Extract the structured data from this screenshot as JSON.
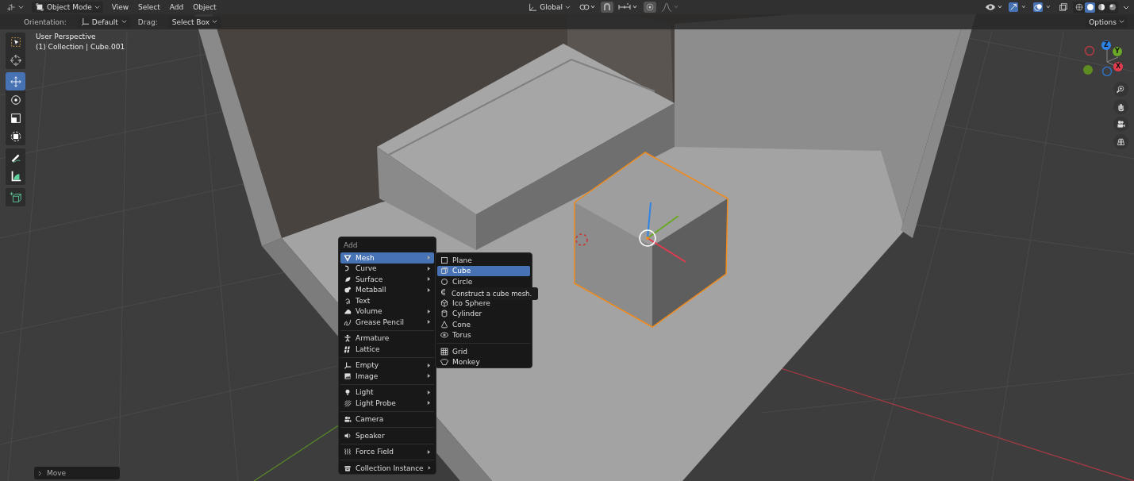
{
  "header": {
    "mode": "Object Mode",
    "menus": [
      "View",
      "Select",
      "Add",
      "Object"
    ],
    "transform_orientation": "Global",
    "shading": [
      {
        "kind": "wireframe",
        "selected": false
      },
      {
        "kind": "solid",
        "selected": true
      },
      {
        "kind": "material",
        "selected": false
      },
      {
        "kind": "rendered",
        "selected": false
      }
    ]
  },
  "tool_settings": {
    "orientation_label": "Orientation:",
    "orientation": "Default",
    "drag_label": "Drag:",
    "drag": "Select Box",
    "options": "Options"
  },
  "viewport": {
    "title": "User Perspective",
    "subtitle": "(1) Collection | Cube.001"
  },
  "toolbar": [
    [
      {
        "kind": "select-box",
        "selected": false
      },
      {
        "kind": "cursor",
        "selected": false
      }
    ],
    [
      {
        "kind": "move",
        "selected": true
      },
      {
        "kind": "rotate",
        "selected": false
      },
      {
        "kind": "scale",
        "selected": false
      },
      {
        "kind": "transform",
        "selected": false
      }
    ],
    [
      {
        "kind": "annotate",
        "selected": false
      },
      {
        "kind": "measure",
        "selected": false
      }
    ],
    [
      {
        "kind": "add-cube",
        "selected": false
      }
    ]
  ],
  "gizmo_axes": [
    {
      "label": "Z",
      "color": "#2e83e6"
    },
    {
      "label": "Y",
      "color": "#6ba827"
    },
    {
      "label": "X",
      "color": "#e63a4f"
    }
  ],
  "add_menu": {
    "title": "Add",
    "sections": [
      [
        {
          "label": "Mesh",
          "submenu": true,
          "selected": true
        },
        {
          "label": "Curve",
          "submenu": true,
          "selected": false
        },
        {
          "label": "Surface",
          "submenu": true,
          "selected": false
        },
        {
          "label": "Metaball",
          "submenu": true,
          "selected": false
        },
        {
          "label": "Text",
          "submenu": false,
          "selected": false
        },
        {
          "label": "Volume",
          "submenu": true,
          "selected": false
        },
        {
          "label": "Grease Pencil",
          "submenu": true,
          "selected": false
        }
      ],
      [
        {
          "label": "Armature",
          "submenu": false,
          "selected": false
        },
        {
          "label": "Lattice",
          "submenu": false,
          "selected": false
        }
      ],
      [
        {
          "label": "Empty",
          "submenu": true,
          "selected": false
        },
        {
          "label": "Image",
          "submenu": true,
          "selected": false
        }
      ],
      [
        {
          "label": "Light",
          "submenu": true,
          "selected": false
        },
        {
          "label": "Light Probe",
          "submenu": true,
          "selected": false
        }
      ],
      [
        {
          "label": "Camera",
          "submenu": false,
          "selected": false
        }
      ],
      [
        {
          "label": "Speaker",
          "submenu": false,
          "selected": false
        }
      ],
      [
        {
          "label": "Force Field",
          "submenu": true,
          "selected": false
        }
      ],
      [
        {
          "label": "Collection Instance",
          "submenu": true,
          "selected": false
        }
      ]
    ]
  },
  "mesh_menu": {
    "sections": [
      [
        {
          "label": "Plane",
          "selected": false
        },
        {
          "label": "Cube",
          "selected": true
        },
        {
          "label": "Circle",
          "selected": false
        },
        {
          "selected": false
        },
        {
          "label": "Ico Sphere",
          "selected": false
        },
        {
          "label": "Cylinder",
          "selected": false
        },
        {
          "label": "Cone",
          "selected": false
        },
        {
          "label": "Torus",
          "selected": false
        }
      ],
      [
        {
          "label": "Grid",
          "selected": false
        },
        {
          "label": "Monkey",
          "selected": false
        }
      ]
    ]
  },
  "tooltip": "Construct a cube mesh.",
  "last_operator": {
    "label": "Move",
    "expanded": false
  }
}
